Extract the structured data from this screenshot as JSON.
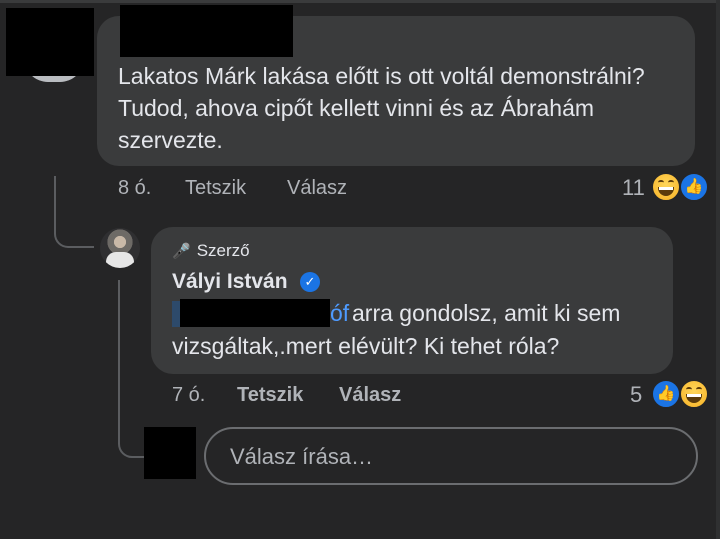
{
  "comment": {
    "text": "Lakatos Márk lakása előtt is ott voltál demonstrálni? Tudod, ahova cipőt kellett vinni és az Ábrahám szervezte.",
    "time": "8 ó.",
    "like_label": "Tetszik",
    "reply_label": "Válasz",
    "reaction_count": "11",
    "reactions": [
      "haha-icon",
      "like-icon"
    ]
  },
  "reply": {
    "badge": "Szerző",
    "author": "Vályi István",
    "mention_tail": "óf",
    "text_line1": "arra gondolsz, amit ki sem",
    "text_line2": "vizsgáltak,.mert elévült? Ki tehet róla?",
    "time": "7 ó.",
    "like_label": "Tetszik",
    "reply_label": "Válasz",
    "reaction_count": "5",
    "reactions": [
      "like-icon",
      "haha-icon"
    ]
  },
  "composer": {
    "placeholder": "Válasz írása…"
  },
  "colors": {
    "background": "#252526",
    "bubble": "#3a3b3c",
    "text": "#e4e6eb",
    "secondary_text": "#b0b3b8",
    "link": "#4e9bff",
    "like_blue": "#1b74e4"
  }
}
